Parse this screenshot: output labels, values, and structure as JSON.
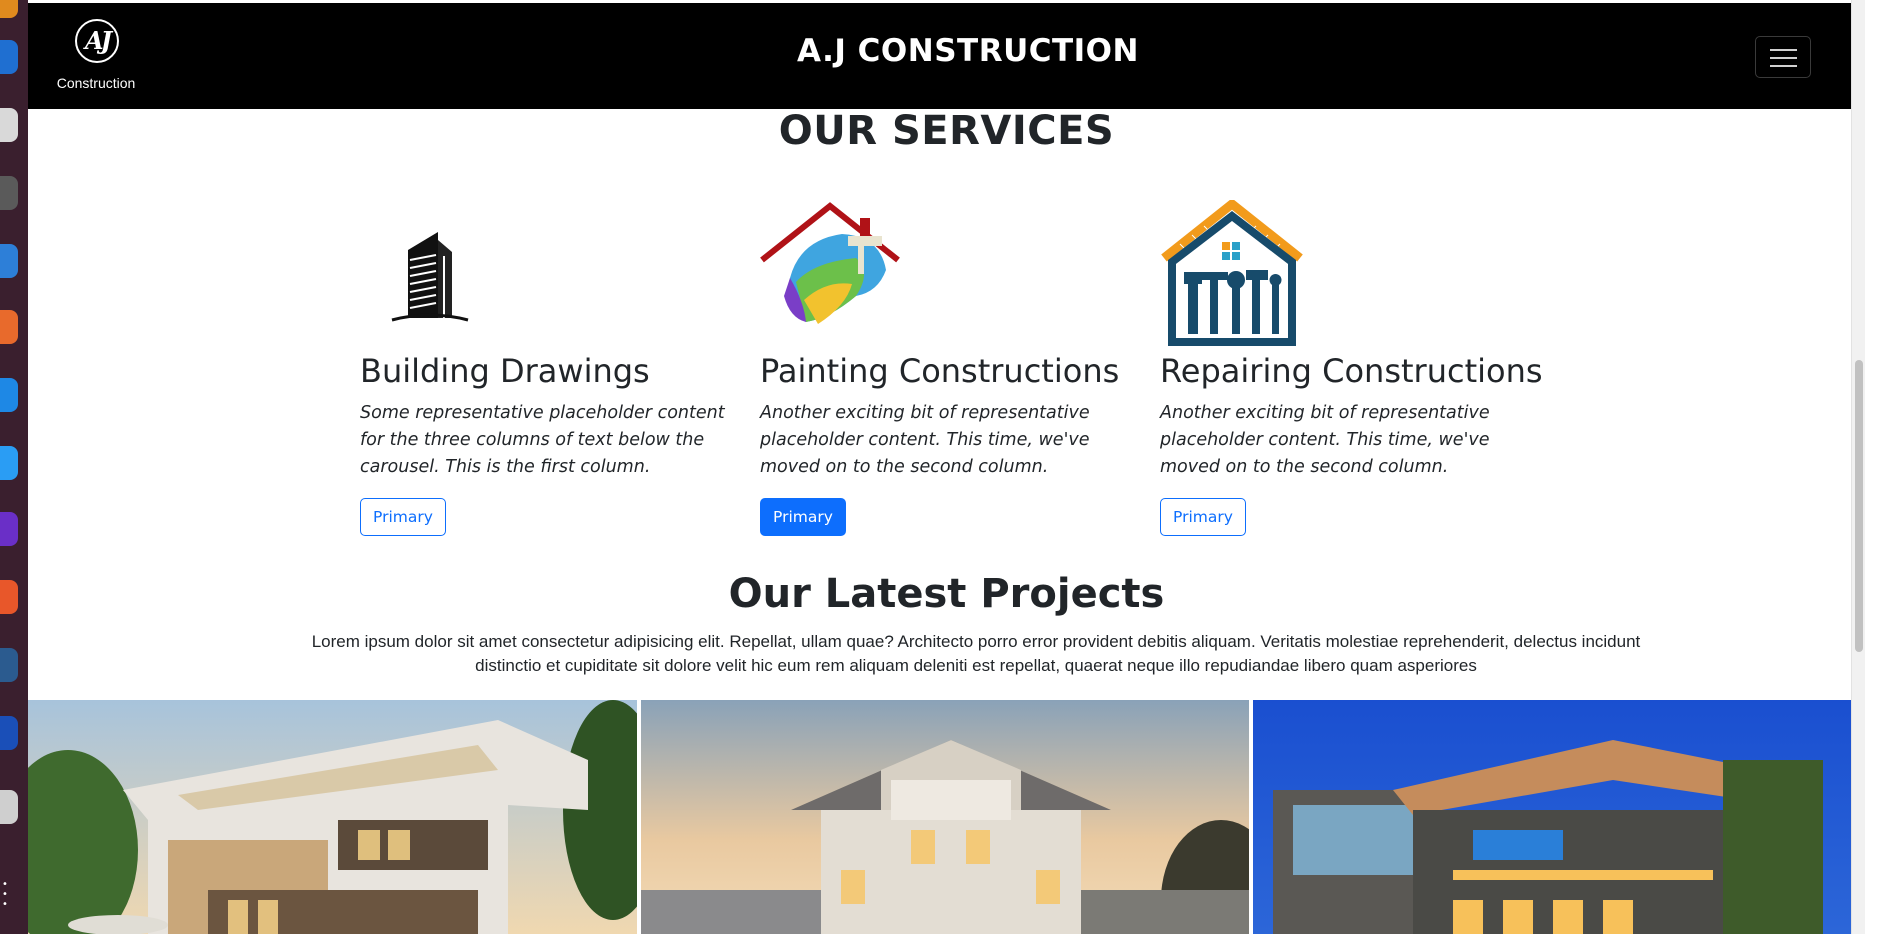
{
  "navbar": {
    "logo_mark": "AJ",
    "logo_text": "Construction",
    "brand": "A.J CONSTRUCTION",
    "menu_icon": "hamburger-menu-icon"
  },
  "services": {
    "title": "OUR SERVICES",
    "items": [
      {
        "icon": "skyscraper-icon",
        "heading": "Building Drawings",
        "text": "Some representative placeholder content for the three columns of text below the carousel. This is the first column.",
        "button": "Primary",
        "button_style": "outline"
      },
      {
        "icon": "paint-house-icon",
        "heading": "Painting Constructions",
        "text": "Another exciting bit of representative placeholder content. This time, we've moved on to the second column.",
        "button": "Primary",
        "button_style": "filled"
      },
      {
        "icon": "repair-house-icon",
        "heading": "Repairing Constructions",
        "text": "Another exciting bit of representative placeholder content. This time, we've moved on to the second column.",
        "button": "Primary",
        "button_style": "outline"
      }
    ]
  },
  "projects": {
    "title": "Our Latest Projects",
    "description": "Lorem ipsum dolor sit amet consectetur adipisicing elit. Repellat, ullam quae? Architecto porro error provident debitis aliquam. Veritatis molestiae reprehenderit, delectus incidunt distinctio et cupiditate sit dolore velit hic eum rem aliquam deleniti est repellat, quaerat neque illo repudiandae libero quam asperiores"
  },
  "colors": {
    "primary": "#0d6efd",
    "navbar_bg": "#000000",
    "text": "#212529"
  }
}
